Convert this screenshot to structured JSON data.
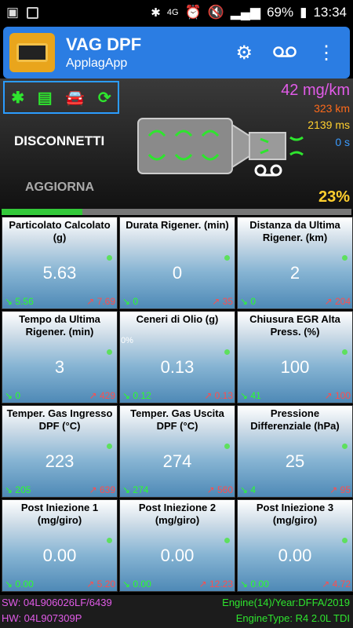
{
  "status_bar": {
    "battery": "69%",
    "clock": "13:34",
    "network": "4G"
  },
  "app": {
    "title": "VAG DPF",
    "subtitle": "ApplagApp",
    "settings_icon": "gear-icon",
    "record_icon": "voicemail-icon",
    "menu_icon": "more-vert-icon"
  },
  "header": {
    "disconnect_label": "DISCONNETTI",
    "refresh_label": "AGGIORNA",
    "soot": "42 mg/km",
    "distance": "323 km",
    "time_ms": "2139 ms",
    "seconds": "0 s",
    "percent": "23%",
    "progress_fraction": 0.23
  },
  "cells": [
    {
      "label": "Particolato Calcolato (g)",
      "value": "5.63",
      "min": "5.56",
      "max": "7.69"
    },
    {
      "label": "Durata Rigener. (min)",
      "value": "0",
      "min": "0",
      "max": "35"
    },
    {
      "label": "Distanza da Ultima Rigener. (km)",
      "value": "2",
      "min": "0",
      "max": "204"
    },
    {
      "label": "Tempo da Ultima Rigener. (min)",
      "value": "3",
      "min": "0",
      "max": "429"
    },
    {
      "label": "Ceneri di Olio (g)",
      "value": "0.13",
      "min": "0.12",
      "max": "0.13",
      "extra": "0%"
    },
    {
      "label": "Chiusura EGR Alta Press. (%)",
      "value": "100",
      "min": "41",
      "max": "100"
    },
    {
      "label": "Temper. Gas Ingresso DPF (°C)",
      "value": "223",
      "min": "205",
      "max": "639"
    },
    {
      "label": "Temper. Gas Uscita DPF (°C)",
      "value": "274",
      "min": "274",
      "max": "560"
    },
    {
      "label": "Pressione Differenziale (hPa)",
      "value": "25",
      "min": "4",
      "max": "95"
    },
    {
      "label": "Post Iniezione 1 (mg/giro)",
      "value": "0.00",
      "min": "0.00",
      "max": "5.20"
    },
    {
      "label": "Post Iniezione 2 (mg/giro)",
      "value": "0.00",
      "min": "0.00",
      "max": "12.23"
    },
    {
      "label": "Post Iniezione 3 (mg/giro)",
      "value": "0.00",
      "min": "0.00",
      "max": "4.72"
    }
  ],
  "footer": {
    "sw": "SW: 04L906026LF/6439",
    "hw": "HW: 04L907309P",
    "engine": "Engine(14)/Year:DFFA/2019",
    "engine_type": "EngineType: R4 2.0L TDI"
  }
}
